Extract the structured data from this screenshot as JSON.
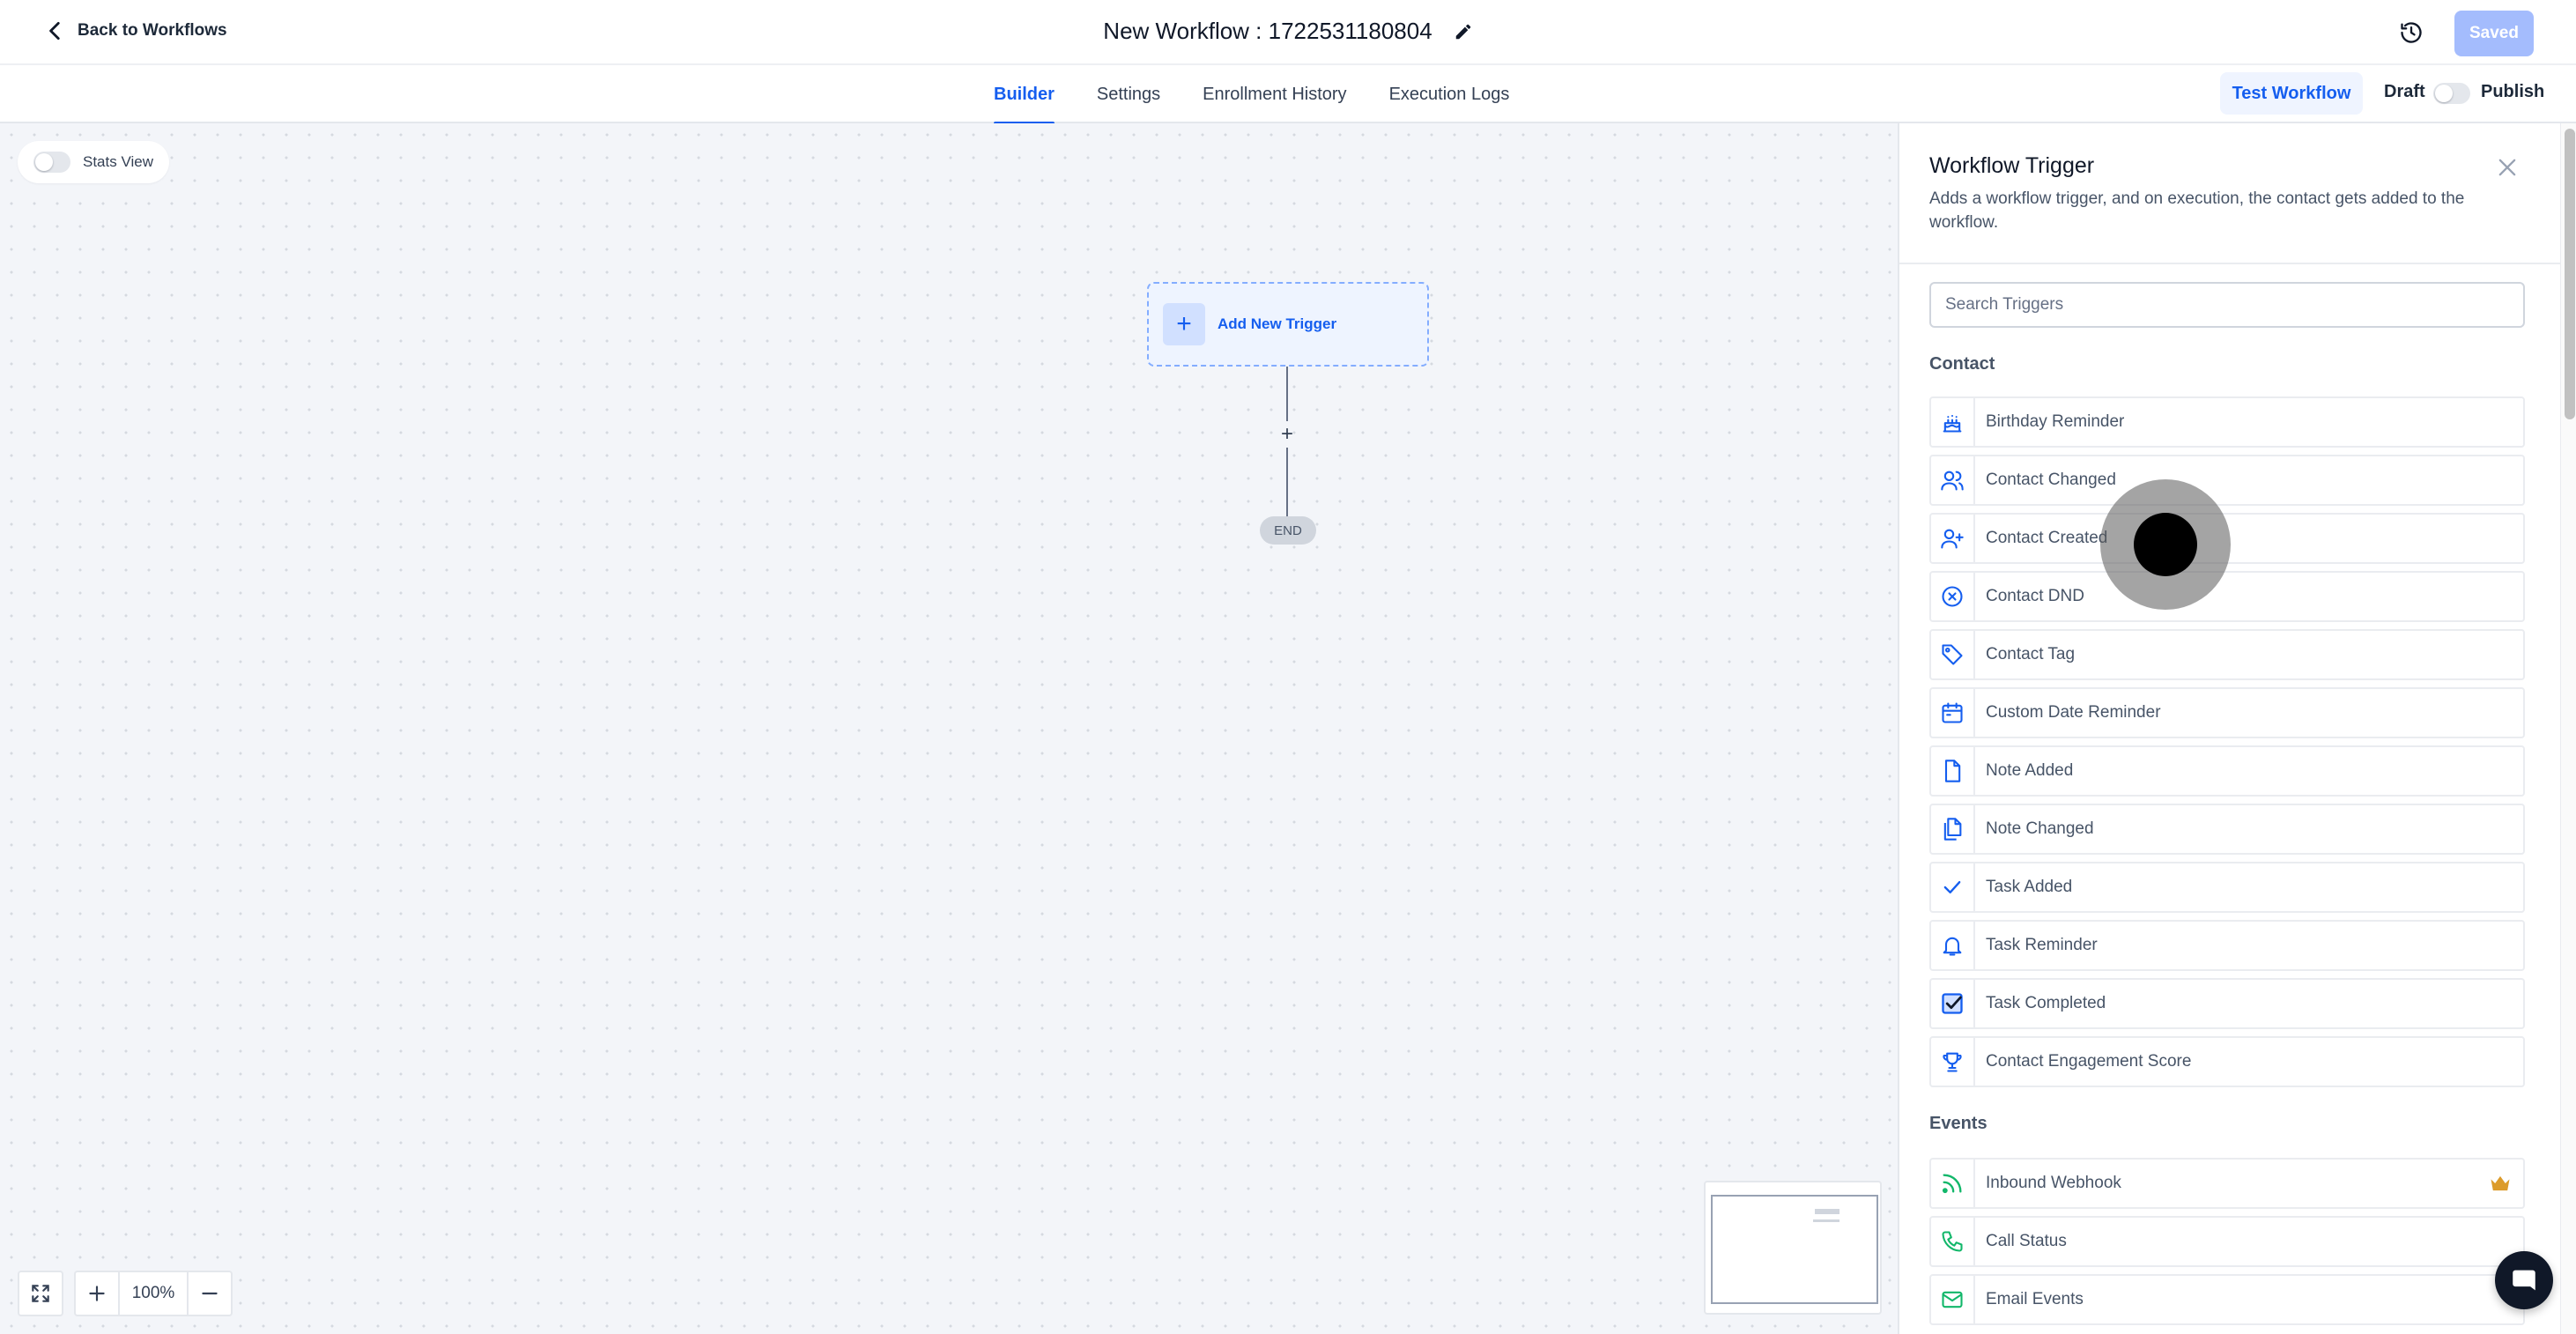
{
  "header": {
    "back_label": "Back to Workflows",
    "workflow_title": "New Workflow : 1722531180804",
    "saved_label": "Saved"
  },
  "tabs": [
    {
      "label": "Builder",
      "active": true
    },
    {
      "label": "Settings",
      "active": false
    },
    {
      "label": "Enrollment History",
      "active": false
    },
    {
      "label": "Execution Logs",
      "active": false
    }
  ],
  "actions": {
    "test_label": "Test Workflow",
    "draft_label": "Draft",
    "publish_label": "Publish",
    "published": false
  },
  "canvas": {
    "stats_view_label": "Stats View",
    "stats_view_on": false,
    "add_trigger_label": "Add New Trigger",
    "end_label": "END",
    "zoom_label": "100%"
  },
  "panel": {
    "title": "Workflow Trigger",
    "description": "Adds a workflow trigger, and on execution, the contact gets added to the workflow.",
    "search_placeholder": "Search Triggers",
    "contact_section": "Contact",
    "contact_items": [
      {
        "label": "Birthday Reminder",
        "icon": "cake-icon"
      },
      {
        "label": "Contact Changed",
        "icon": "users-icon"
      },
      {
        "label": "Contact Created",
        "icon": "user-plus-icon"
      },
      {
        "label": "Contact DND",
        "icon": "x-circle-icon"
      },
      {
        "label": "Contact Tag",
        "icon": "tag-icon"
      },
      {
        "label": "Custom Date Reminder",
        "icon": "calendar-icon"
      },
      {
        "label": "Note Added",
        "icon": "file-icon"
      },
      {
        "label": "Note Changed",
        "icon": "files-icon"
      },
      {
        "label": "Task Added",
        "icon": "check-icon"
      },
      {
        "label": "Task Reminder",
        "icon": "bell-icon"
      },
      {
        "label": "Task Completed",
        "icon": "check-square-icon"
      },
      {
        "label": "Contact Engagement Score",
        "icon": "trophy-icon"
      }
    ],
    "events_section": "Events",
    "events_items": [
      {
        "label": "Inbound Webhook",
        "icon": "rss-icon",
        "premium": true
      },
      {
        "label": "Call Status",
        "icon": "phone-icon",
        "premium": false
      },
      {
        "label": "Email Events",
        "icon": "mail-icon",
        "premium": false
      }
    ]
  },
  "colors": {
    "primary": "#155eef",
    "contact_icon": "#155eef",
    "event_icon": "#12b76a",
    "saved_button": "#a4bcfd",
    "crown": "#dc9b2a"
  }
}
